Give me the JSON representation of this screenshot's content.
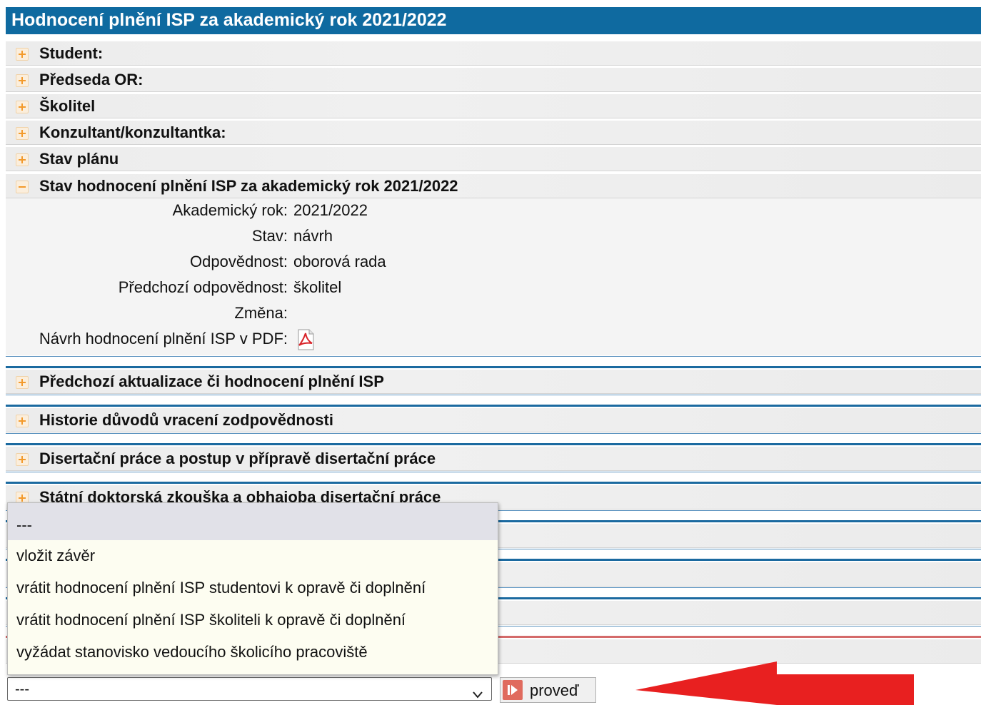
{
  "page": {
    "title": "Hodnocení plnění ISP za akademický rok 2021/2022"
  },
  "sections": [
    {
      "label": "Student:"
    },
    {
      "label": "Předseda OR:"
    },
    {
      "label": "Školitel"
    },
    {
      "label": "Konzultant/konzultantka:"
    },
    {
      "label": "Stav plánu"
    },
    {
      "label": "Stav hodnocení plnění ISP za akademický rok 2021/2022"
    },
    {
      "label": "Předchozí aktualizace či hodnocení plnění ISP"
    },
    {
      "label": "Historie důvodů vracení zodpovědnosti"
    },
    {
      "label": "Disertační práce a postup v přípravě disertační práce"
    },
    {
      "label": "Státní doktorská zkouška a obhajoba disertační práce"
    }
  ],
  "detail": {
    "rows": [
      {
        "label": "Akademický rok:",
        "value": "2021/2022"
      },
      {
        "label": "Stav:",
        "value": "návrh"
      },
      {
        "label": "Odpovědnost:",
        "value": "oborová rada"
      },
      {
        "label": "Předchozí odpovědnost:",
        "value": "školitel"
      },
      {
        "label": "Změna:",
        "value": ""
      },
      {
        "label": "Návrh hodnocení plnění ISP v PDF:",
        "value": ""
      }
    ],
    "pdf_icon": "pdf-icon"
  },
  "action": {
    "options": [
      "---",
      "vložit závěr",
      "vrátit hodnocení plnění ISP studentovi k opravě či doplnění",
      "vrátit hodnocení plnění ISP školiteli k opravě či doplnění",
      "vyžádat stanovisko vedoucího školicího pracoviště"
    ],
    "selected": "---",
    "button_label": "proveď"
  },
  "colors": {
    "title_bar": "#0f6aa0",
    "toggle_accent": "#f39a2b",
    "arrow": "#e82020"
  }
}
